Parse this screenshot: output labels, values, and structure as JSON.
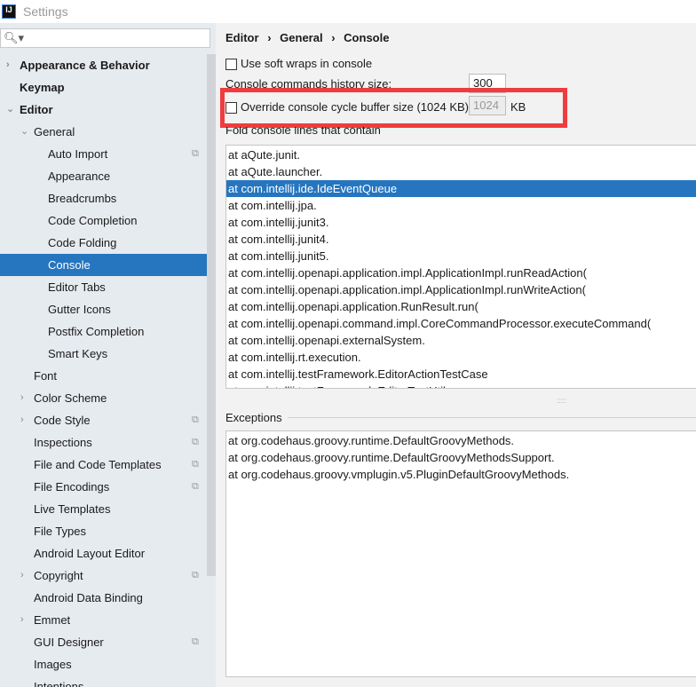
{
  "window": {
    "title": "Settings",
    "logo": "IJ"
  },
  "sidebar": {
    "search_icon": "search-icon",
    "items": [
      {
        "label": "Appearance & Behavior",
        "level": 0,
        "bold": true,
        "arrow": "right"
      },
      {
        "label": "Keymap",
        "level": 0,
        "bold": true
      },
      {
        "label": "Editor",
        "level": 0,
        "bold": true,
        "arrow": "down"
      },
      {
        "label": "General",
        "level": 1,
        "arrow": "down"
      },
      {
        "label": "Auto Import",
        "level": 2,
        "copy": true
      },
      {
        "label": "Appearance",
        "level": 2
      },
      {
        "label": "Breadcrumbs",
        "level": 2
      },
      {
        "label": "Code Completion",
        "level": 2
      },
      {
        "label": "Code Folding",
        "level": 2
      },
      {
        "label": "Console",
        "level": 2,
        "selected": true
      },
      {
        "label": "Editor Tabs",
        "level": 2
      },
      {
        "label": "Gutter Icons",
        "level": 2
      },
      {
        "label": "Postfix Completion",
        "level": 2
      },
      {
        "label": "Smart Keys",
        "level": 2
      },
      {
        "label": "Font",
        "level": 1
      },
      {
        "label": "Color Scheme",
        "level": 1,
        "arrow": "right"
      },
      {
        "label": "Code Style",
        "level": 1,
        "arrow": "right",
        "copy": true
      },
      {
        "label": "Inspections",
        "level": 1,
        "copy": true
      },
      {
        "label": "File and Code Templates",
        "level": 1,
        "copy": true
      },
      {
        "label": "File Encodings",
        "level": 1,
        "copy": true
      },
      {
        "label": "Live Templates",
        "level": 1
      },
      {
        "label": "File Types",
        "level": 1
      },
      {
        "label": "Android Layout Editor",
        "level": 1
      },
      {
        "label": "Copyright",
        "level": 1,
        "arrow": "right",
        "copy": true
      },
      {
        "label": "Android Data Binding",
        "level": 1
      },
      {
        "label": "Emmet",
        "level": 1,
        "arrow": "right"
      },
      {
        "label": "GUI Designer",
        "level": 1,
        "copy": true
      },
      {
        "label": "Images",
        "level": 1
      },
      {
        "label": "Intentions",
        "level": 1
      }
    ]
  },
  "main": {
    "breadcrumb": [
      "Editor",
      "General",
      "Console"
    ],
    "soft_wraps_label": "Use soft wraps in console",
    "soft_wraps_checked": false,
    "history_label": "Console commands history size:",
    "history_value": "300",
    "override_label": "Override console cycle buffer size (1024 KB)",
    "override_checked": false,
    "override_value": "1024",
    "override_unit": "KB",
    "fold_label": "Fold console lines that contain",
    "fold_lines": [
      "at aQute.junit.",
      "at aQute.launcher.",
      "at com.intellij.ide.IdeEventQueue",
      "at com.intellij.jpa.",
      "at com.intellij.junit3.",
      "at com.intellij.junit4.",
      "at com.intellij.junit5.",
      "at com.intellij.openapi.application.impl.ApplicationImpl.runReadAction(",
      "at com.intellij.openapi.application.impl.ApplicationImpl.runWriteAction(",
      "at com.intellij.openapi.application.RunResult.run(",
      "at com.intellij.openapi.command.impl.CoreCommandProcessor.executeCommand(",
      "at com.intellij.openapi.externalSystem.",
      "at com.intellij.rt.execution.",
      "at com.intellij.testFramework.EditorActionTestCase",
      "at com.intellij.testFramework.EditorTestUtil"
    ],
    "fold_selected": 2,
    "exceptions_label": "Exceptions",
    "exceptions": [
      "at org.codehaus.groovy.runtime.DefaultGroovyMethods.",
      "at org.codehaus.groovy.runtime.DefaultGroovyMethodsSupport.",
      "at org.codehaus.groovy.vmplugin.v5.PluginDefaultGroovyMethods."
    ]
  }
}
